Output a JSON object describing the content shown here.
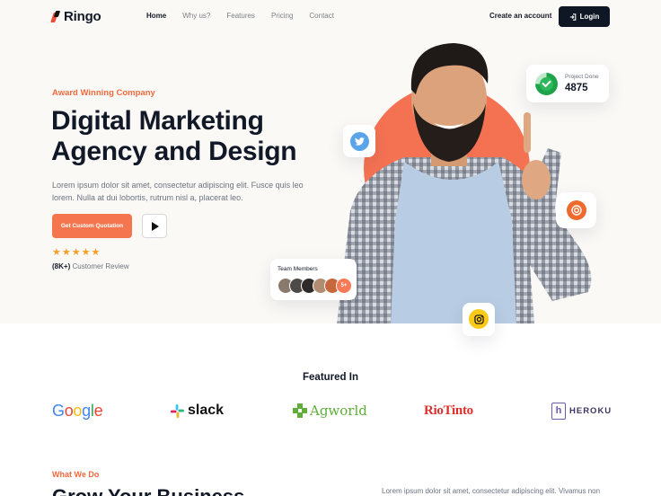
{
  "brand": {
    "name": "Ringo"
  },
  "nav": {
    "items": [
      "Home",
      "Why us?",
      "Features",
      "Pricing",
      "Contact"
    ],
    "active": "Home",
    "create_account": "Create an account",
    "login": "Login"
  },
  "hero": {
    "eyebrow": "Award Winning Company",
    "headline_line1": "Digital Marketing",
    "headline_line2": "Agency and Design",
    "lede": "Lorem ipsum dolor sit amet, consectetur adipiscing elit. Fusce quis leo lorem. Nulla at dui lobortis, rutrum nisl a, placerat leo.",
    "cta": "Get Custom Quotation",
    "rating_stars": 5,
    "review_count": "(8K+)",
    "review_label": "Customer Review"
  },
  "project_card": {
    "label": "Project Done",
    "value": "4875",
    "progress": 0.75
  },
  "team_card": {
    "label": "Team Members",
    "more": "5+"
  },
  "featured": {
    "title": "Featured In",
    "brands": [
      "Google",
      "slack",
      "Agworld",
      "RioTinto",
      "HEROKU"
    ]
  },
  "what_we_do": {
    "eyebrow": "What We Do",
    "title": "Grow Your Business",
    "text": "Lorem ipsum dolor sit amet, consectetur adipiscing elit. Vivamus non"
  },
  "colors": {
    "accent": "#f26a3d",
    "dark": "#0f1724",
    "hero_bg": "#fbf9f6",
    "star": "#f59e2b"
  }
}
